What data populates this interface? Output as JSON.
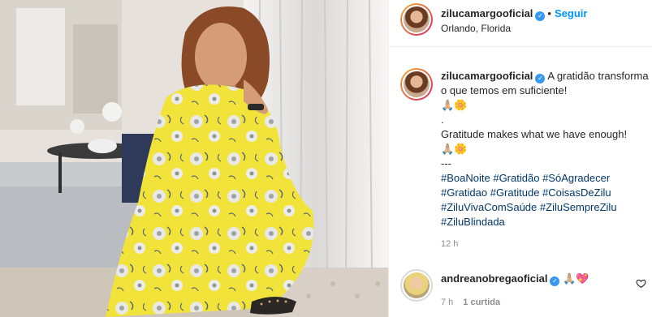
{
  "post_header": {
    "username": "zilucamargooficial",
    "separator": "•",
    "follow_label": "Seguir",
    "location": "Orlando, Florida"
  },
  "caption": {
    "username": "zilucamargooficial",
    "line1": "A gratidão transforma o que temos em suficiente!",
    "emoji1": "🙏🏼🌼",
    "dot_line": ".",
    "line2": "Gratitude makes what we have enough!",
    "emoji2": "🙏🏼🌼",
    "dashes": "---",
    "hashtags": [
      "#BoaNoite",
      "#Gratidão",
      "#SóAgradecer",
      "#Gratidao",
      "#Gratitude",
      "#CoisasDeZilu",
      "#ZiluVivaComSaúde",
      "#ZiluSempreZilu",
      "#ZiluBlindada"
    ],
    "time": "12 h"
  },
  "comment": {
    "username": "andreanobregaoficial",
    "text": "🙏🏼💖",
    "time": "7 h",
    "likes": "1 curtida"
  },
  "icons": {
    "verified": "verified-badge-icon",
    "heart": "heart-outline-icon"
  },
  "colors": {
    "link_blue": "#0095f6",
    "hashtag": "#00376b",
    "verified": "#3897f0",
    "muted": "#8e8e8e"
  }
}
